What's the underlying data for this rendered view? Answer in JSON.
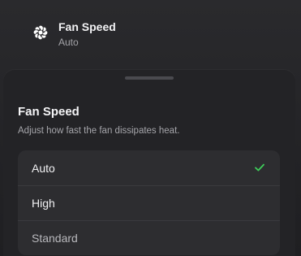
{
  "setting_row": {
    "icon": "fan-icon",
    "title": "Fan Speed",
    "value": "Auto"
  },
  "sheet": {
    "title": "Fan Speed",
    "description": "Adjust how fast the fan dissipates heat.",
    "options": [
      {
        "label": "Auto",
        "selected": true
      },
      {
        "label": "High",
        "selected": false
      },
      {
        "label": "Standard",
        "selected": false
      }
    ]
  },
  "colors": {
    "check": "#3ecf5a"
  }
}
